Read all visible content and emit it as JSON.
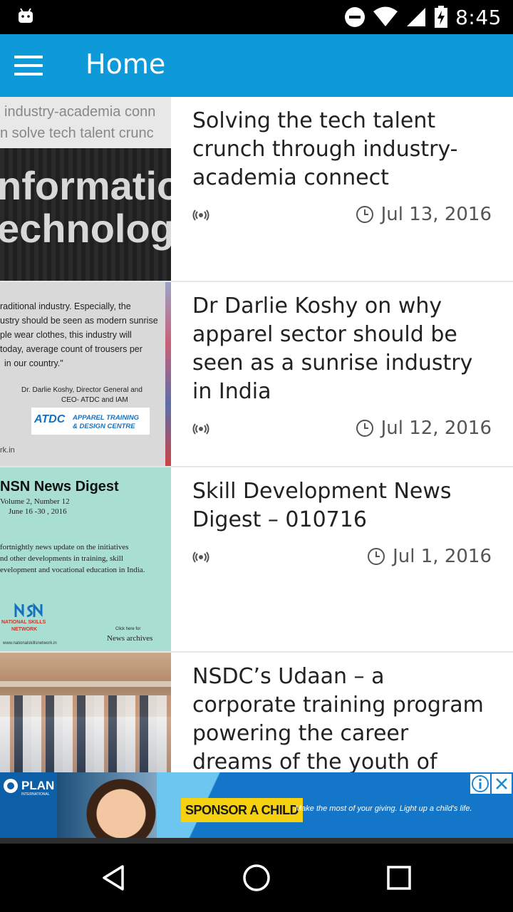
{
  "status_bar": {
    "time": "8:45",
    "icons": [
      "android-icon",
      "do-not-disturb-icon",
      "wifi-icon",
      "signal-icon",
      "battery-icon"
    ]
  },
  "app_bar": {
    "title": "Home",
    "menu_icon": "hamburger-menu-icon",
    "background": "#0e9ad8"
  },
  "articles": [
    {
      "title": "Solving the tech talent crunch through industry-academia connect",
      "date": "Jul 13, 2016",
      "thumb": {
        "top_line_1": "industry-academia conn",
        "top_line_2": "n solve tech talent crunc",
        "big_1": "nformation",
        "big_2": "echnology"
      }
    },
    {
      "title": "Dr Darlie Koshy on why apparel sector should be seen as a sunrise industry in India",
      "date": "Jul 12, 2016",
      "thumb": {
        "quote_lines": [
          "raditional industry. Especially, the",
          "ustry should be seen as modern sunrise",
          "ple wear clothes, this industry will",
          "today, average count of trousers per",
          "in our country.\""
        ],
        "attribution_1": "Dr. Darlie Koshy, Director General and",
        "attribution_2": "CEO- ATDC and IAM",
        "logo_short": "ATDC",
        "logo_line_1": "APPAREL TRAINING",
        "logo_line_2": "& DESIGN CENTRE",
        "footer": "rk.in"
      }
    },
    {
      "title": "Skill Development News Digest – 010716",
      "date": "Jul 1, 2016",
      "thumb": {
        "heading": "NSN News Digest",
        "vol": "Volume 2, Number 12",
        "dates": "June 16 -30 , 2016",
        "body_lines": [
          "fortnightly news update on the initiatives",
          "nd other developments in training, skill",
          "evelopment and vocational education in India."
        ],
        "org_1": "NATIONAL SKILLS",
        "org_2": "NETWORK",
        "click": "Click here for",
        "archives": "News archives",
        "url": "www.nationalskillsnetwork.in"
      }
    },
    {
      "title": "NSDC’s Udaan – a corporate training program powering the career dreams of the youth of Jammu and",
      "date": ""
    }
  ],
  "ad": {
    "brand": "PLAN",
    "brand_sub": "INTERNATIONAL",
    "cta": "SPONSOR A CHILD",
    "tagline": "Make the most of your giving. Light up a child's life.",
    "info_icon": "info-icon",
    "close_icon": "close-icon"
  },
  "nav_bar": {
    "buttons": [
      "back-icon",
      "home-icon",
      "recents-icon"
    ]
  }
}
